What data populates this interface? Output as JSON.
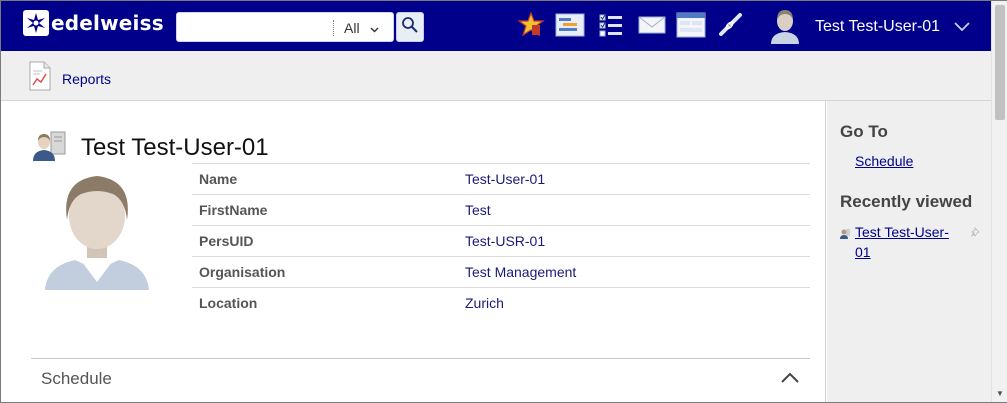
{
  "brand": {
    "name": "edelweiss"
  },
  "search": {
    "value": "",
    "scope": "All"
  },
  "header_icons": [
    "favorites-star-icon",
    "project-board-icon",
    "task-checklist-icon",
    "mail-icon",
    "forms-icon",
    "link-icon"
  ],
  "user": {
    "name": "Test Test-User-01"
  },
  "subnav": {
    "reports_label": "Reports"
  },
  "profile": {
    "title": "Test Test-User-01",
    "fields": [
      {
        "label": "Name",
        "value": "Test-User-01"
      },
      {
        "label": "FirstName",
        "value": "Test"
      },
      {
        "label": "PersUID",
        "value": "Test-USR-01"
      },
      {
        "label": "Organisation",
        "value": "Test Management"
      },
      {
        "label": "Location",
        "value": "Zurich"
      }
    ]
  },
  "schedule": {
    "title": "Schedule"
  },
  "sidebar": {
    "goto_heading": "Go To",
    "goto_links": [
      "Schedule"
    ],
    "recent_heading": "Recently viewed",
    "recent_items": [
      "Test Test-User-01"
    ]
  },
  "colors": {
    "header_bg": "#00008b",
    "link": "#00008b",
    "panel_bg": "#efefef"
  }
}
